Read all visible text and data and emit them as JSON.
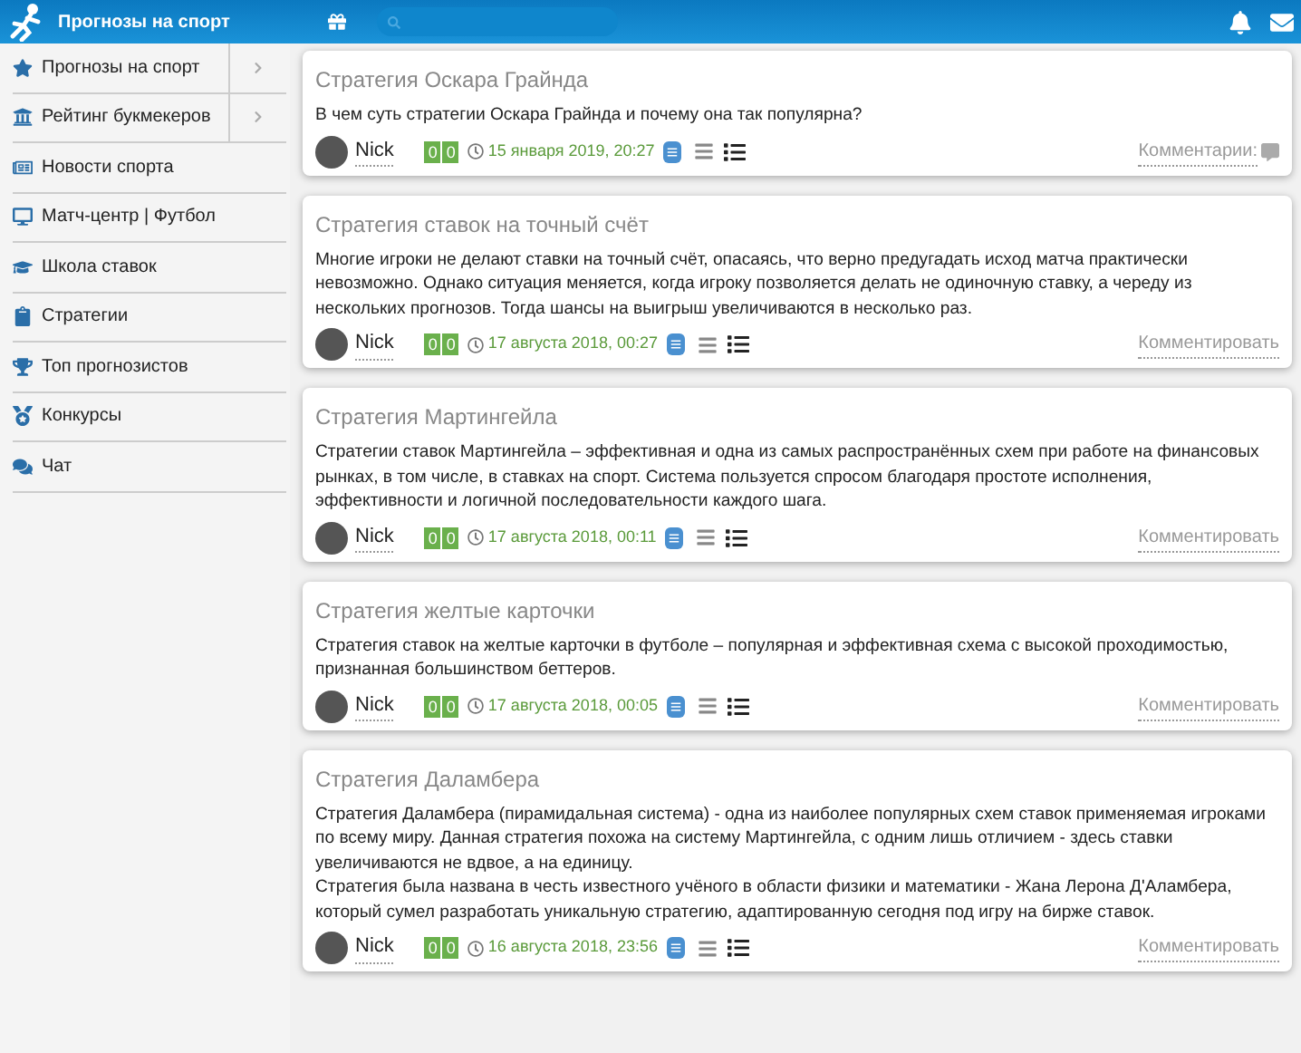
{
  "header": {
    "site_title": "Прогнозы на спорт"
  },
  "sidebar": {
    "items": [
      {
        "label": "Прогнозы на спорт",
        "has_submenu": true
      },
      {
        "label": "Рейтинг букмекеров",
        "has_submenu": true
      },
      {
        "label": "Новости спорта",
        "has_submenu": false
      },
      {
        "label": "Матч-центр | Футбол",
        "has_submenu": false
      },
      {
        "label": "Школа ставок",
        "has_submenu": false
      },
      {
        "label": "Стратегии",
        "has_submenu": false
      },
      {
        "label": "Топ прогнозистов",
        "has_submenu": false
      },
      {
        "label": "Конкурсы",
        "has_submenu": false
      },
      {
        "label": "Чат",
        "has_submenu": false
      }
    ]
  },
  "posts": [
    {
      "title": "Стратегия Оскара Грайнда",
      "paragraphs": [
        "В чем суть стратегии Оскара Грайнда и почему она так популярна?"
      ],
      "author": "Nick",
      "score": [
        "0",
        "0"
      ],
      "date": "15 января 2019, 20:27",
      "comments": "Комментарии:",
      "has_comment_count": true
    },
    {
      "title": "Стратегия ставок на точный счёт",
      "paragraphs": [
        "Многие игроки не делают ставки на точный счёт, опасаясь, что верно предугадать исход матча практически невозможно. Однако ситуация меняется, когда игроку позволяется делать не одиночную ставку, а череду из нескольких прогнозов. Тогда шансы на выигрыш увеличиваются в несколько раз."
      ],
      "author": "Nick",
      "score": [
        "0",
        "0"
      ],
      "date": "17 августа 2018, 00:27",
      "comments": "Комментировать",
      "has_comment_count": false
    },
    {
      "title": "Стратегия Мартингейла",
      "paragraphs": [
        "Стратегии ставок Мартингейла – эффективная и одна из самых распространённых схем при работе на финансовых рынках, в том числе, в ставках на спорт. Система пользуется спросом благодаря простоте исполнения, эффективности и логичной последовательности каждого шага."
      ],
      "author": "Nick",
      "score": [
        "0",
        "0"
      ],
      "date": "17 августа 2018, 00:11",
      "comments": "Комментировать",
      "has_comment_count": false
    },
    {
      "title": "Стратегия желтые карточки",
      "paragraphs": [
        "Стратегия ставок на желтые карточки в футболе – популярная и эффективная схема с высокой проходимостью, признанная большинством беттеров."
      ],
      "author": "Nick",
      "score": [
        "0",
        "0"
      ],
      "date": "17 августа 2018, 00:05",
      "comments": "Комментировать",
      "has_comment_count": false
    },
    {
      "title": "Стратегия Даламбера",
      "paragraphs": [
        "Стратегия Даламбера (пирамидальная система) - одна из наиболее популярных схем ставок применяемая игроками по всему миру. Данная стратегия похожа на систему Мартингейла, с одним лишь отличием - здесь ставки увеличиваются не вдвое, а на единицу.",
        "Стратегия была названа в честь известного учёного в области физики и математики - Жана Лерона Д'Аламбера, который сумел разработать уникальную стратегию, адаптированную сегодня под игру на бирже ставок."
      ],
      "author": "Nick",
      "score": [
        "0",
        "0"
      ],
      "date": "16 августа 2018, 23:56",
      "comments": "Комментировать",
      "has_comment_count": false
    }
  ]
}
